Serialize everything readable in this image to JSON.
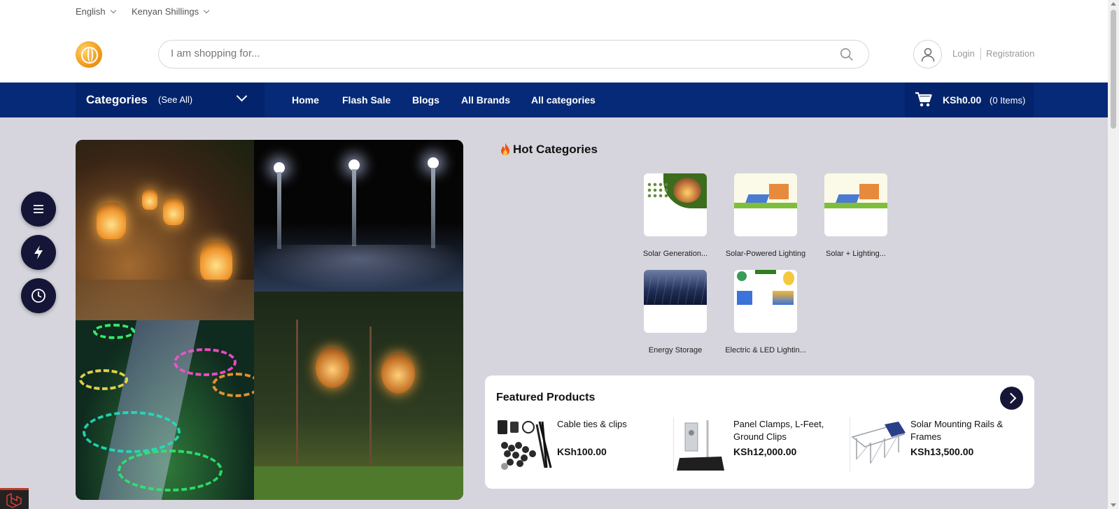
{
  "topbar": {
    "language": "English",
    "currency": "Kenyan Shillings"
  },
  "header": {
    "search_placeholder": "I am shopping for...",
    "login": "Login",
    "registration": "Registration"
  },
  "nav": {
    "categories_title": "Categories",
    "see_all": "(See All)",
    "links": [
      "Home",
      "Flash Sale",
      "Blogs",
      "All Brands",
      "All categories"
    ],
    "cart_amount": "KSh0.00",
    "cart_items": "(0 Items)"
  },
  "hot_categories": {
    "title": "Hot Categories",
    "items": [
      "Solar Generation...",
      "Solar-Powered Lighting",
      "Solar + Lighting...",
      "Energy Storage",
      "Electric & LED Lightin..."
    ]
  },
  "featured": {
    "title": "Featured Products",
    "products": [
      {
        "name": "Cable ties & clips",
        "price": "KSh100.00"
      },
      {
        "name": "Panel Clamps, L-Feet, Ground Clips",
        "price": "KSh12,000.00"
      },
      {
        "name": "Solar Mounting Rails & Frames",
        "price": "KSh13,500.00"
      }
    ]
  },
  "colors": {
    "nav_bg": "#062a77",
    "nav_dark": "#03246c",
    "fab_bg": "#151637",
    "page_bg": "#d6d5dd"
  },
  "icons": {
    "fab": [
      "menu-icon",
      "lightning-icon",
      "clock-icon"
    ]
  }
}
